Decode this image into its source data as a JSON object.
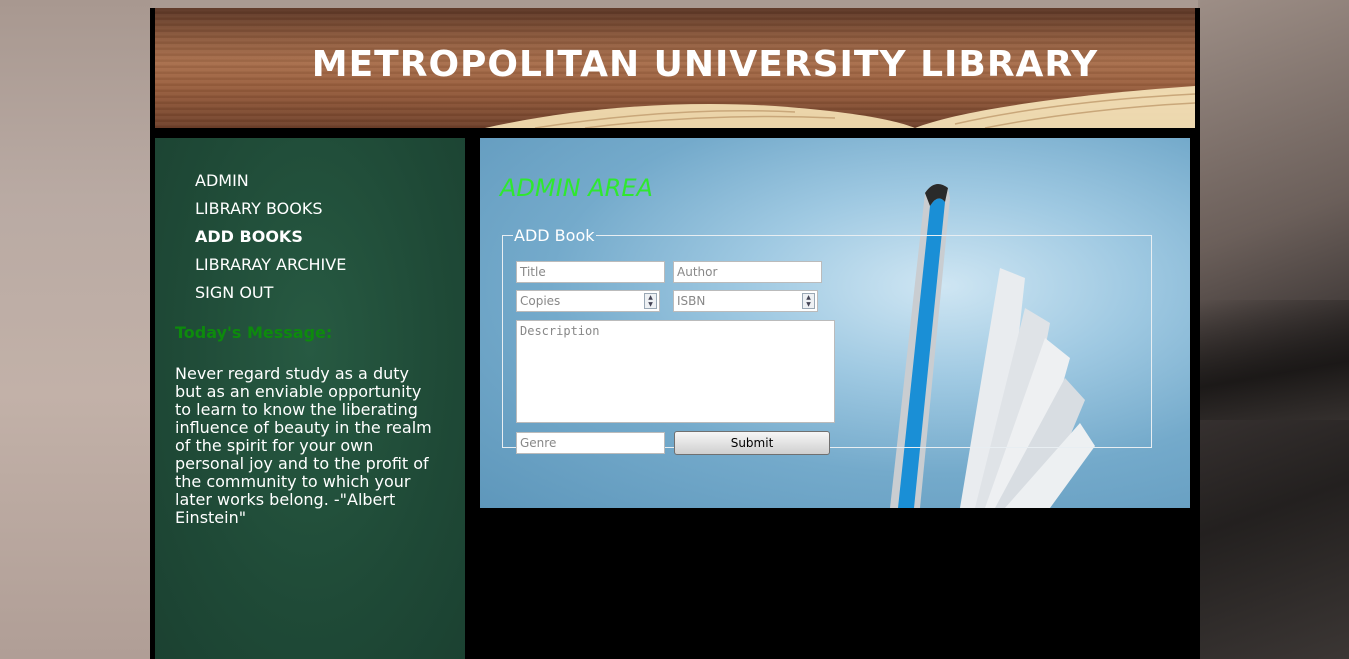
{
  "header": {
    "title": "METROPOLITAN UNIVERSITY LIBRARY"
  },
  "sidebar": {
    "nav": [
      {
        "label": "ADMIN",
        "active": false
      },
      {
        "label": "LIBRARY BOOKS",
        "active": false
      },
      {
        "label": "ADD BOOKS",
        "active": true
      },
      {
        "label": "LIBRARAY ARCHIVE",
        "active": false
      },
      {
        "label": "SIGN OUT",
        "active": false
      }
    ],
    "message_title": "Today's Message:",
    "message_text": "Never regard study as a duty but as an enviable opportunity to learn to know the liberating influence of beauty in the realm of the spirit for your own personal joy and to the profit of the community to which your later works belong. -\"Albert Einstein\""
  },
  "main": {
    "area_title": "ADMIN AREA",
    "form": {
      "legend": "ADD Book",
      "title_placeholder": "Title",
      "author_placeholder": "Author",
      "copies_placeholder": "Copies",
      "isbn_placeholder": "ISBN",
      "description_placeholder": "Description",
      "genre_placeholder": "Genre",
      "submit_label": "Submit"
    }
  },
  "colors": {
    "sidebar_bg": "#1f4a37",
    "message_title": "#0d8a0d",
    "area_title": "#2fe82f"
  }
}
